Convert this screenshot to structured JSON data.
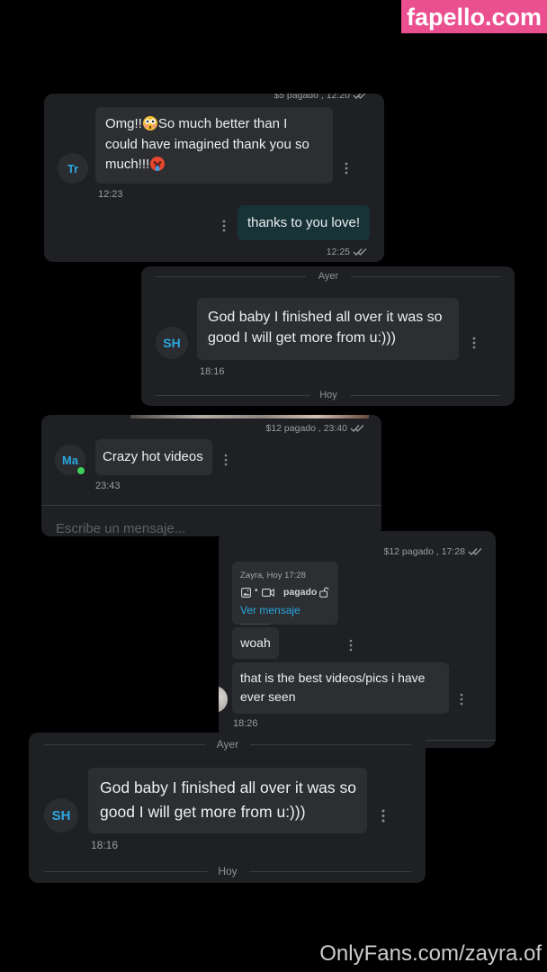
{
  "watermarks": {
    "site": "fapello.com",
    "creator": "OnlyFans.com/zayra.of"
  },
  "colors": {
    "background": "#000000",
    "card": "#1f2023",
    "bubble_received": "#2c2e32",
    "bubble_sent": "#173338",
    "accent_blue": "#2aa7e0",
    "online_green": "#3ecf5a",
    "watermark_pink": "#ea4f8f"
  },
  "icons": {
    "read_receipt": "double-check-icon",
    "message_menu": "kebab-menu-icon",
    "media_photo": "image-icon",
    "media_video": "video-icon",
    "locked": "lock-icon",
    "emoji_1": "flushed-face-emoji",
    "emoji_2": "hot-face-emoji"
  },
  "chat1": {
    "paid_status": "$5 pagado , 12:20",
    "avatar_initials": "Tr",
    "received": {
      "part1": "Omg!!",
      "part2": "So much better than I could have imagined thank you so much!!!",
      "time": "12:23"
    },
    "sent": {
      "text": "thanks to you love!",
      "time": "12:25"
    }
  },
  "chat2": {
    "divider_top": "Ayer",
    "avatar_initials": "SH",
    "message": "God baby I finished all over it was so good I will get more from u:)))",
    "time": "18:16",
    "divider_bottom": "Hoy"
  },
  "chat3": {
    "paid_status": "$12 pagado , 23:40",
    "avatar_initials": "Ma",
    "message": "Crazy hot videos",
    "time": "23:43",
    "composer_placeholder": "Escribe un mensaje..."
  },
  "chat4": {
    "paid_status": "$12 pagado , 17:28",
    "quote": {
      "meta": "Zayra, Hoy 17:28",
      "separator": "•",
      "status": "pagado",
      "link": "Ver mensaje"
    },
    "messages": [
      "woah",
      "that is the best videos/pics i have ever seen"
    ],
    "time": "18:26"
  },
  "chat5": {
    "divider_top": "Ayer",
    "avatar_initials": "SH",
    "message": "God baby I finished all over it was so good I will get more from u:)))",
    "time": "18:16",
    "divider_bottom": "Hoy"
  }
}
